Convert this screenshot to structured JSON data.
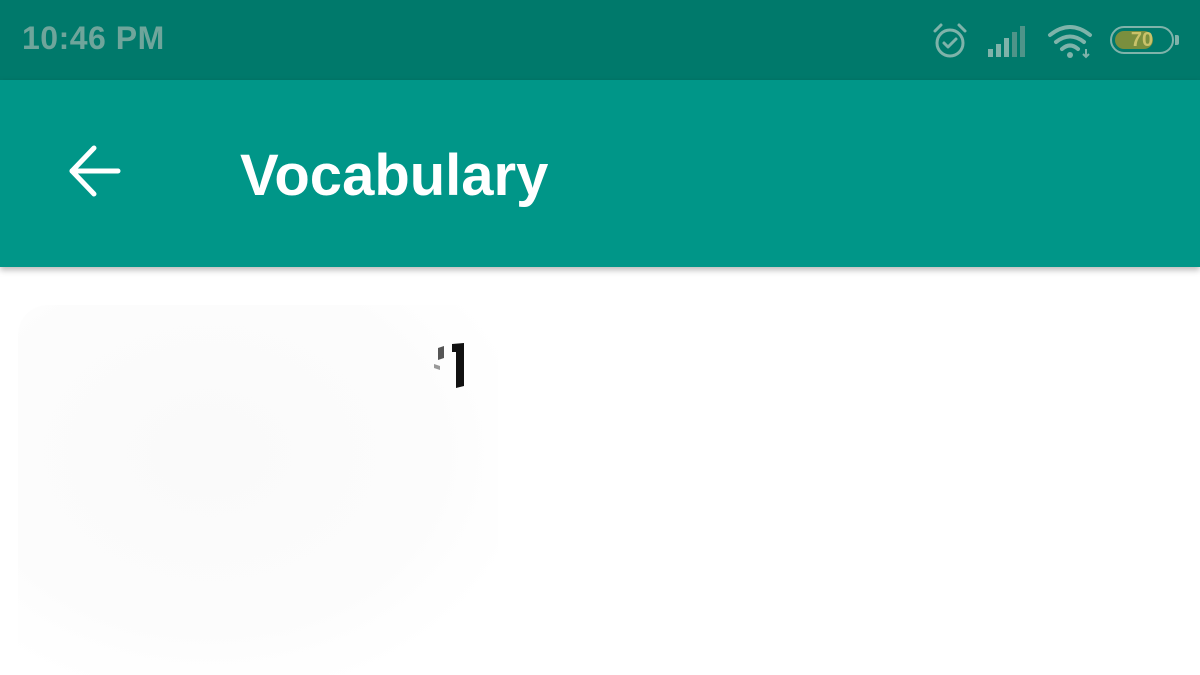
{
  "status_bar": {
    "time": "10:46 PM",
    "battery_level": "70",
    "battery_fraction": 0.7,
    "icons": [
      "alarm-icon",
      "cellular-signal-icon",
      "wifi-icon",
      "battery-icon"
    ]
  },
  "app_bar": {
    "title": "Vocabulary",
    "back_icon": "arrow-left-icon"
  },
  "colors": {
    "status_bar": "#00796b",
    "app_bar": "#009688",
    "title_text": "#ffffff",
    "background": "#ffffff"
  }
}
